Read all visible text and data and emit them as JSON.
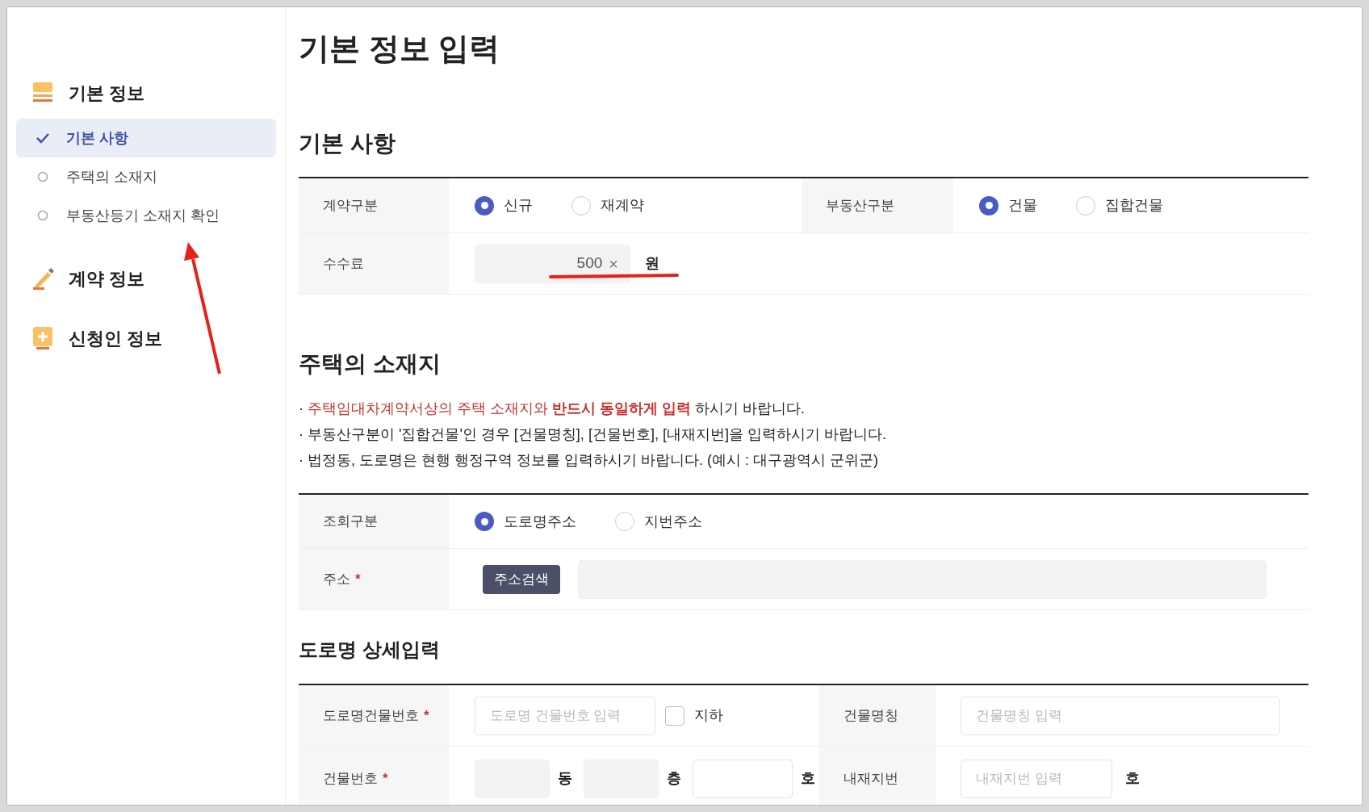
{
  "page_title": "기본 정보 입력",
  "sidebar": {
    "groups": [
      {
        "label": "기본 정보",
        "items": [
          {
            "label": "기본 사항",
            "selected": true
          },
          {
            "label": "주택의 소재지",
            "selected": false
          },
          {
            "label": "부동산등기 소재지 확인",
            "selected": false
          }
        ]
      },
      {
        "label": "계약 정보"
      },
      {
        "label": "신청인 정보"
      }
    ]
  },
  "sections": [
    {
      "title": "기본 사항",
      "rows": [
        {
          "cells": [
            {
              "label": "계약구분",
              "kind": "radios",
              "options": [
                {
                  "label": "신규",
                  "selected": true
                },
                {
                  "label": "재계약",
                  "selected": false
                }
              ]
            },
            {
              "label": "부동산구분",
              "kind": "radios",
              "options": [
                {
                  "label": "건물",
                  "selected": true
                },
                {
                  "label": "집합건물",
                  "selected": false
                }
              ]
            }
          ]
        },
        {
          "cells": [
            {
              "label": "수수료",
              "kind": "amount",
              "value": "500",
              "clear": "×",
              "unit": "원"
            }
          ]
        }
      ]
    },
    {
      "title": "주택의 소재지",
      "notes": [
        [
          {
            "text": "· ",
            "kind": "plain"
          },
          {
            "text": "주택임대차계약서상의 주택 소재지와 ",
            "kind": "warning"
          },
          {
            "text": "반드시 동일하게 입력",
            "kind": "emphasis"
          },
          {
            "text": " 하시기 바랍니다.",
            "kind": "plain"
          }
        ],
        [
          {
            "text": "· 부동산구분이 '집합건물'인 경우 [건물명칭], [건물번호], [내재지번]을 입력하시기 바랍니다.",
            "kind": "plain"
          }
        ],
        [
          {
            "text": "· 법정동, 도로명은 현행 행정구역 정보를 입력하시기 바랍니다. (예시 : 대구광역시 군위군)",
            "kind": "plain"
          }
        ]
      ],
      "rows": [
        {
          "cells": [
            {
              "label": "조회구분",
              "kind": "radios",
              "options": [
                {
                  "label": "도로명주소",
                  "selected": true
                },
                {
                  "label": "지번주소",
                  "selected": false
                }
              ]
            }
          ]
        },
        {
          "cells": [
            {
              "label": "주소",
              "mark": "*",
              "kind": "search",
              "button": "주소검색"
            }
          ]
        }
      ]
    },
    {
      "title": "도로명 상세입력",
      "rows": [
        {
          "cells": [
            {
              "label": "도로명건물번호",
              "mark": "*",
              "kind": "text-check",
              "placeholder": "도로명 건물번호 입력",
              "check": {
                "label": "지하",
                "checked": false
              }
            },
            {
              "label": "건물명칭",
              "kind": "text",
              "placeholder": "건물명칭 입력"
            }
          ]
        },
        {
          "cells": [
            {
              "label": "건물번호",
              "mark": "*",
              "kind": "units",
              "units": [
                "동",
                "층",
                "호"
              ]
            },
            {
              "label": "내재지번",
              "kind": "text-unit",
              "placeholder": "내재지번 입력",
              "unit": "호"
            }
          ]
        }
      ]
    }
  ],
  "arrow_annotation": true,
  "underline_annotation": true
}
